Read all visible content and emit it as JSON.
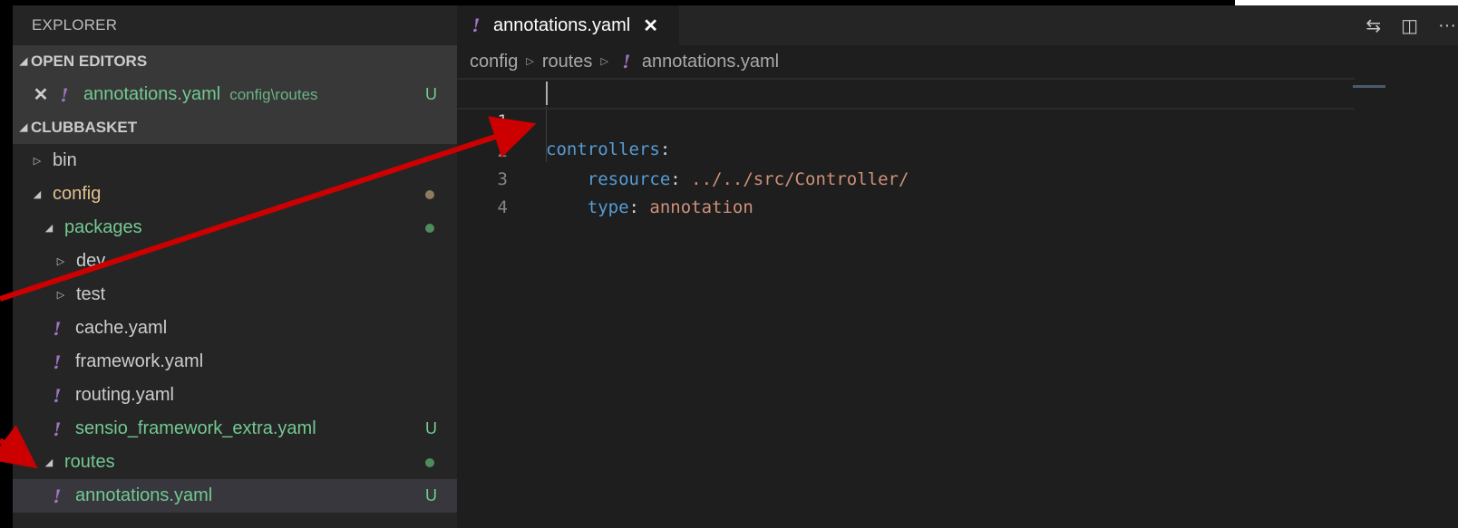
{
  "sidebar": {
    "title": "EXPLORER",
    "open_editors": {
      "header": "OPEN EDITORS",
      "items": [
        {
          "name": "annotations.yaml",
          "path": "config\\routes",
          "badge": "U"
        }
      ]
    },
    "project": {
      "header": "CLUBBASKET",
      "tree": [
        {
          "label": "bin",
          "type": "folder",
          "expanded": false
        },
        {
          "label": "config",
          "type": "folder",
          "expanded": true
        },
        {
          "label": "packages",
          "type": "folder",
          "expanded": true
        },
        {
          "label": "dev",
          "type": "folder",
          "expanded": false
        },
        {
          "label": "test",
          "type": "folder",
          "expanded": false
        },
        {
          "label": "cache.yaml",
          "type": "yaml"
        },
        {
          "label": "framework.yaml",
          "type": "yaml"
        },
        {
          "label": "routing.yaml",
          "type": "yaml"
        },
        {
          "label": "sensio_framework_extra.yaml",
          "type": "yaml",
          "badge": "U"
        },
        {
          "label": "routes",
          "type": "folder",
          "expanded": true
        },
        {
          "label": "annotations.yaml",
          "type": "yaml",
          "badge": "U"
        }
      ]
    }
  },
  "editor": {
    "tab": {
      "label": "annotations.yaml",
      "icon": "yaml-icon",
      "close": "✕"
    },
    "actions": [
      "open-changes-icon",
      "split-editor-icon",
      "more-actions-icon"
    ],
    "breadcrumb": [
      "config",
      "routes",
      "annotations.yaml"
    ],
    "lines": [
      {
        "num": "1",
        "key": "controllers",
        "sep": ":"
      },
      {
        "num": "2",
        "indent": "    ",
        "key": "resource",
        "sep": ": ",
        "value": "../../src/Controller/"
      },
      {
        "num": "3",
        "indent": "    ",
        "key": "type",
        "sep": ": ",
        "value": "annotation"
      },
      {
        "num": "4"
      }
    ]
  },
  "colors": {
    "annotation_arrow": "#cc0000",
    "untracked": "#73c991",
    "modified_folder": "#e2c08d",
    "yaml_icon": "#a074c4"
  }
}
